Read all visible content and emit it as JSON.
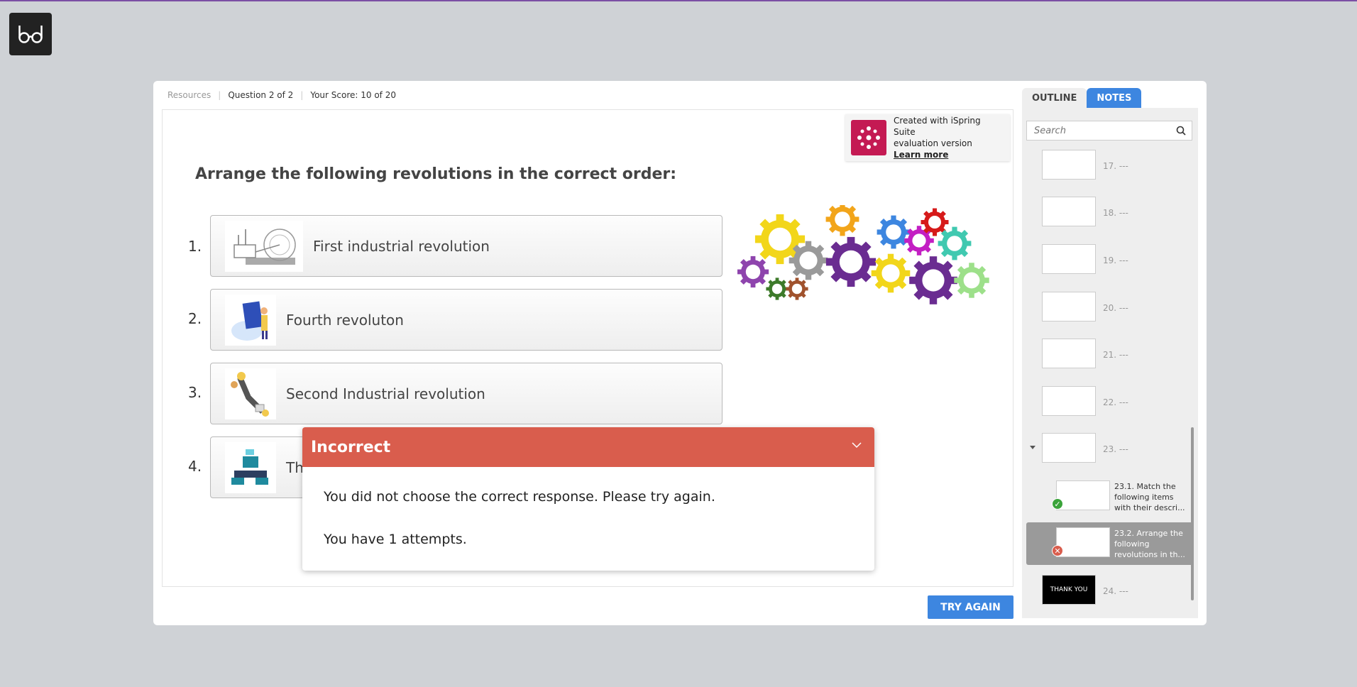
{
  "topbar": {
    "resources": "Resources",
    "question": "Question 2 of 2",
    "score": "Your Score: 10 of 20"
  },
  "ispring": {
    "line1": "Created with iSpring Suite",
    "line2": "evaluation version",
    "link": "Learn more"
  },
  "question": "Arrange the following revolutions in the correct order:",
  "items": [
    {
      "num": "1.",
      "label": "First industrial revolution"
    },
    {
      "num": "2.",
      "label": "Fourth revoluton"
    },
    {
      "num": "3.",
      "label": "Second Industrial revolution"
    },
    {
      "num": "4.",
      "label": "Th"
    }
  ],
  "dialog": {
    "title": "Incorrect",
    "message": "You did not choose the correct response. Please try again.",
    "attempts": "You have 1 attempts."
  },
  "try_again": "TRY AGAIN",
  "sidebar": {
    "tabs": [
      "OUTLINE",
      "NOTES"
    ],
    "search_placeholder": "Search",
    "outline": [
      {
        "label": "17. ---"
      },
      {
        "label": "18. ---"
      },
      {
        "label": "19. ---"
      },
      {
        "label": "20. ---"
      },
      {
        "label": "21. ---"
      },
      {
        "label": "22. ---"
      },
      {
        "label": "23. ---"
      },
      {
        "label": "23.1. Match the following items with their descri..."
      },
      {
        "label": "23.2.  Arrange the following revolutions in th..."
      },
      {
        "label": "24. ---",
        "thumb_text": "THANK YOU"
      }
    ]
  },
  "colors": {
    "accent": "#3d86e0",
    "incorrect": "#d95d4d",
    "brand": "#c41a53",
    "correct_badge": "#3aa33a"
  }
}
